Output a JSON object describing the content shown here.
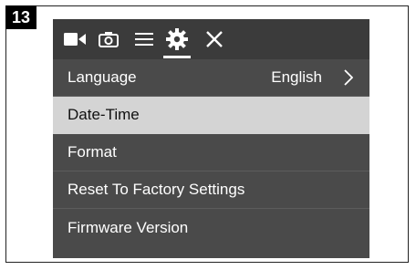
{
  "step": {
    "number": "13"
  },
  "toolbar": {
    "icons": [
      "video-camera-icon",
      "photo-camera-icon",
      "menu-icon",
      "gear-icon",
      "close-icon"
    ],
    "active": "gear-icon"
  },
  "menu": {
    "items": [
      {
        "label": "Language",
        "value": "English",
        "has_arrow": true
      },
      {
        "label": "Date-Time",
        "selected": true
      },
      {
        "label": "Format"
      },
      {
        "label": "Reset To Factory Settings"
      },
      {
        "label": "Firmware Version"
      }
    ]
  },
  "colors": {
    "screen_bg": "#4a4a4a",
    "toolbar_bg": "#3b3b3b",
    "selected_bg": "#d4d4d4",
    "text": "#ffffff"
  }
}
